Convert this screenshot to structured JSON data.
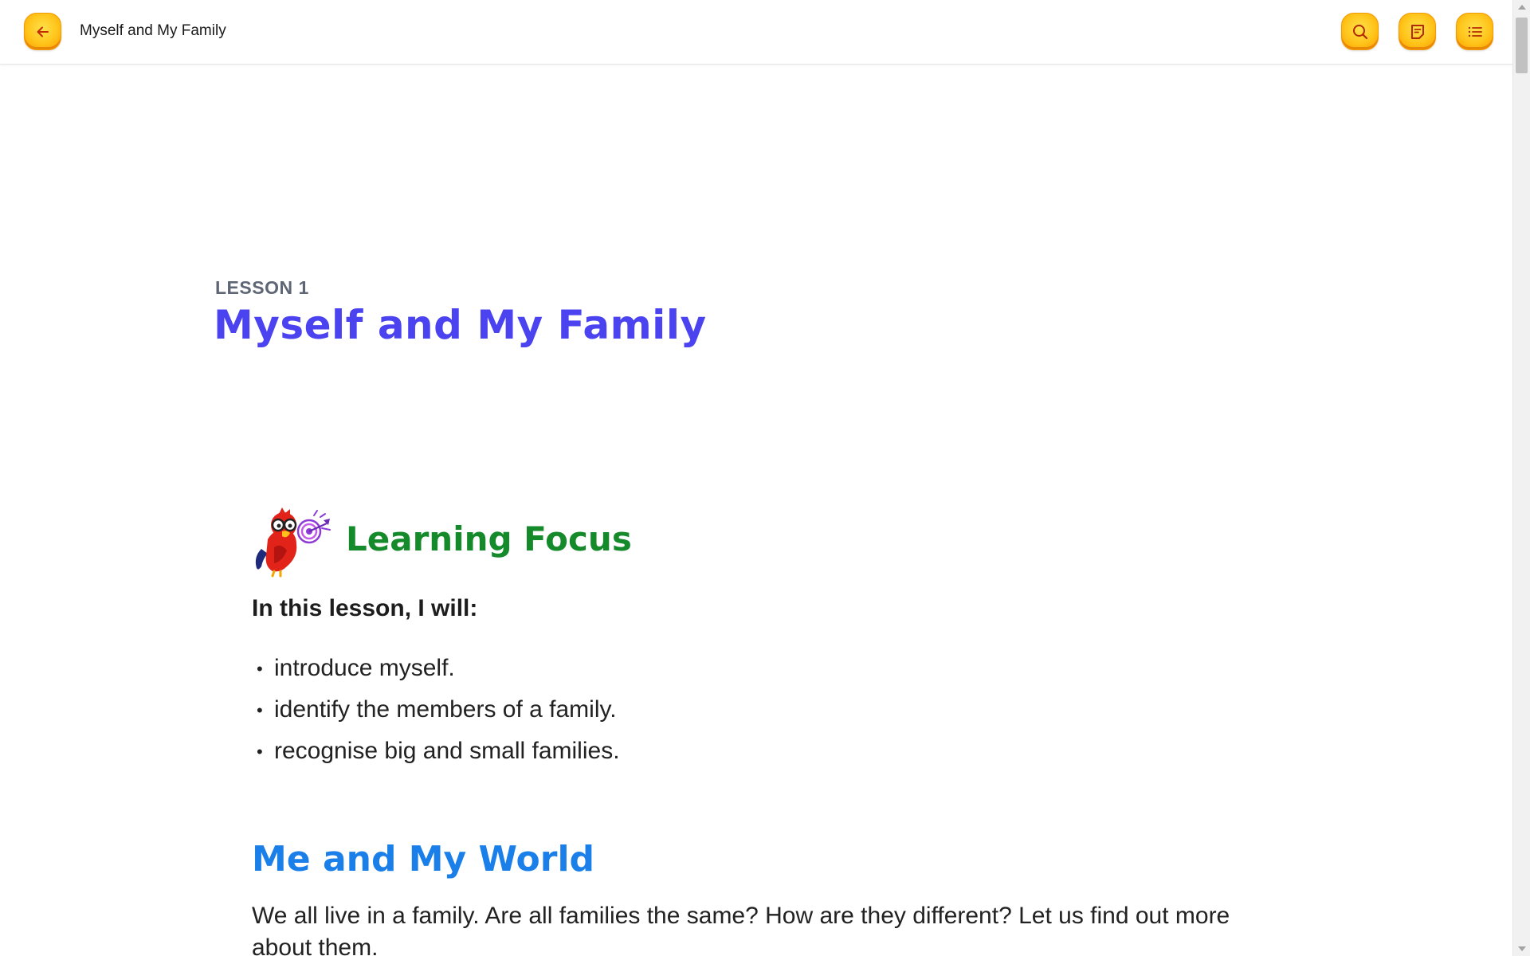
{
  "header": {
    "title": "Myself and My Family",
    "back_icon": "arrow-left-icon",
    "search_icon": "search-icon",
    "notes_icon": "note-icon",
    "contents_icon": "list-icon",
    "button_color": "#ffc41a"
  },
  "lesson": {
    "label": "LESSON 1",
    "title": "Myself and My Family"
  },
  "learning_focus": {
    "heading": "Learning Focus",
    "mascot_icon": "parrot-mascot-icon",
    "intro": "In this lesson, I will:",
    "objectives": [
      "introduce myself.",
      "identify the members of a family.",
      "recognise big and small families."
    ]
  },
  "section": {
    "heading": "Me and My World",
    "text": "We all live in a family. Are all families the same? How are they different? Let us find out more about them."
  },
  "colors": {
    "title": "#4b43f0",
    "focus_heading": "#148a2a",
    "section_heading": "#1a7fe8",
    "label": "#5e6675"
  }
}
